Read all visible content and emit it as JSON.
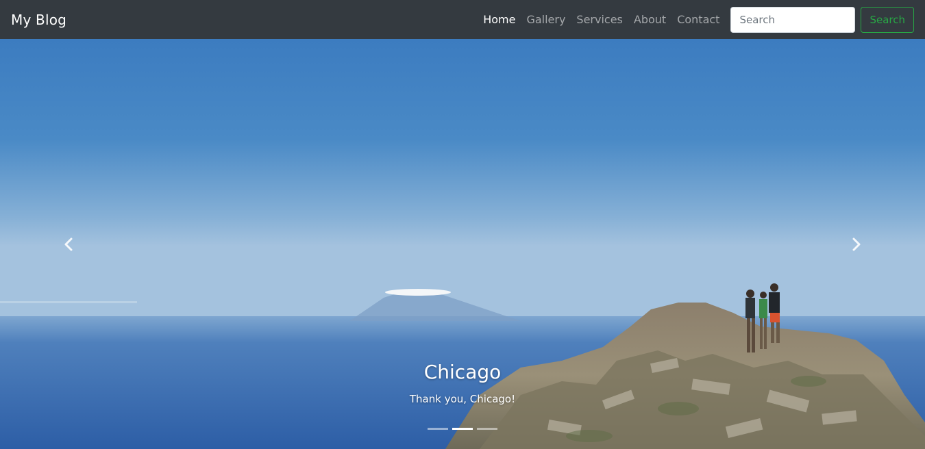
{
  "navbar": {
    "brand": "My Blog",
    "links": [
      {
        "label": "Home",
        "active": true
      },
      {
        "label": "Gallery",
        "active": false
      },
      {
        "label": "Services",
        "active": false
      },
      {
        "label": "About",
        "active": false
      },
      {
        "label": "Contact",
        "active": false
      }
    ],
    "search": {
      "placeholder": "Search",
      "value": "",
      "button_label": "Search"
    }
  },
  "carousel": {
    "caption": {
      "title": "Chicago",
      "text": "Thank you, Chicago!"
    },
    "indicators": {
      "count": 3,
      "active_index": 1
    },
    "controls": {
      "prev_icon": "chevron-left-icon",
      "next_icon": "chevron-right-icon"
    }
  },
  "colors": {
    "navbar_bg": "#343a40",
    "link_active": "#ffffff",
    "link_inactive": "rgba(255,255,255,0.55)",
    "search_button": "#28a745"
  }
}
